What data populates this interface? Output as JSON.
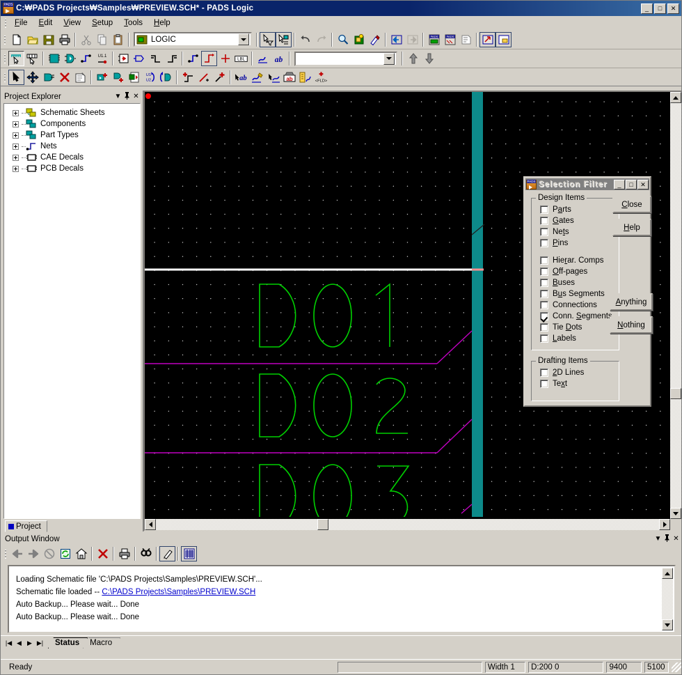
{
  "window": {
    "title": "C:₩PADS Projects₩Samples₩PREVIEW.SCH* - PADS Logic",
    "icon": "pads-app-icon",
    "minimize": "_",
    "maximize": "□",
    "close": "✕"
  },
  "menubar": {
    "items": [
      {
        "label": "File",
        "accel": "F"
      },
      {
        "label": "Edit",
        "accel": "E"
      },
      {
        "label": "View",
        "accel": "V"
      },
      {
        "label": "Setup",
        "accel": "S"
      },
      {
        "label": "Tools",
        "accel": "T"
      },
      {
        "label": "Help",
        "accel": "H"
      }
    ]
  },
  "toolbar_standard": {
    "sheet_combo": {
      "value": "LOGIC",
      "icon": "sheet-icon",
      "arrow": "chevron-down-icon"
    },
    "buttons": [
      "new-file-icon",
      "open-file-icon",
      "save-icon",
      "print-icon",
      "cut-icon",
      "copy-icon",
      "paste-icon",
      "selection-filter-icon",
      "query-modify-icon",
      "undo-icon",
      "redo-icon",
      "zoom-icon",
      "zoom-area-icon",
      "redraw-icon",
      "back-sheet-icon",
      "forward-sheet-icon",
      "pads-router-icon",
      "pads-layout-icon",
      "properties-icon",
      "ole-link-icon",
      "ole-object-icon"
    ]
  },
  "toolbar_design": {
    "filter_value": "",
    "arrow_up": "move-up-icon",
    "arrow_down": "move-down-icon",
    "buttons": [
      "select-net-icon",
      "select-comp-icon",
      "add-part-icon",
      "add-gate-icon",
      "add-connection-icon",
      "add-pin-icon",
      "hierarchical-comp-icon",
      "off-page-icon",
      "bus-icon",
      "bus-segment-icon",
      "connection-icon",
      "conn-segment-icon",
      "tie-dot-icon",
      "label-icon",
      "2d-line-icon",
      "text-icon"
    ]
  },
  "toolbar_edit": {
    "buttons": [
      "select-icon",
      "move-icon",
      "rotate-icon",
      "delete-icon",
      "edit-props-icon",
      "add-part2-icon",
      "add-gate2-icon",
      "add-sheet-icon",
      "swap-refdes-icon",
      "swap-gates-icon",
      "add-conn2-icon",
      "split-conn-icon",
      "add-vertex-icon",
      "rename-net-icon",
      "edit-text-icon",
      "edit-label-icon",
      "attr-icon",
      "field-icon",
      "add-field-icon"
    ]
  },
  "project_explorer": {
    "title": "Project Explorer",
    "dropdown": "▼",
    "pin": "pin-icon",
    "close": "✕",
    "items": [
      {
        "label": "Schematic Sheets",
        "icon": "schematic-sheets-icon",
        "expander": "+"
      },
      {
        "label": "Components",
        "icon": "components-icon",
        "expander": "+"
      },
      {
        "label": "Part Types",
        "icon": "part-types-icon",
        "expander": "+"
      },
      {
        "label": "Nets",
        "icon": "nets-icon",
        "expander": "+"
      },
      {
        "label": "CAE Decals",
        "icon": "cae-decals-icon",
        "expander": "+"
      },
      {
        "label": "PCB Decals",
        "icon": "pcb-decals-icon",
        "expander": "+"
      }
    ],
    "tab": {
      "label": "Project",
      "icon": "project-tab-icon"
    }
  },
  "canvas": {
    "background": "#000000",
    "grid_dot_color": "#ffffff",
    "net_green": "#00d000",
    "bus_magenta": "#c000c0",
    "white_line": "#ffffff",
    "pink_line": "#ff9090",
    "teal_band": "#0d8a8a",
    "origin_marker": "#ff0000",
    "labels": [
      "D01",
      "D02",
      "D03"
    ]
  },
  "selection_filter": {
    "title": "Selection Filter",
    "icon": "pads-app-icon",
    "minimize": "_",
    "maximize": "□",
    "close": "✕",
    "groups": [
      {
        "label": "Design Items",
        "items": [
          {
            "label": "Parts",
            "accel_index": 1,
            "checked": false
          },
          {
            "label": "Gates",
            "accel_index": 0,
            "checked": false
          },
          {
            "label": "Nets",
            "accel_index": 2,
            "checked": false
          },
          {
            "label": "Pins",
            "accel_index": 0,
            "checked": false
          },
          {
            "label": "Hierar. Comps",
            "accel_index": 4,
            "checked": false
          },
          {
            "label": "Off-pages",
            "accel_index": 0,
            "checked": false
          },
          {
            "label": "Buses",
            "accel_index": 0,
            "checked": false
          },
          {
            "label": "Bus Segments",
            "accel_index": 1,
            "checked": false
          },
          {
            "label": "Connections",
            "accel_index": 0,
            "checked": false
          },
          {
            "label": "Conn. Segments",
            "accel_index": 6,
            "checked": true
          },
          {
            "label": "Tie Dots",
            "accel_index": 4,
            "checked": false
          },
          {
            "label": "Labels",
            "accel_index": 0,
            "checked": false
          }
        ]
      },
      {
        "label": "Drafting Items",
        "items": [
          {
            "label": "2D Lines",
            "accel_index": 0,
            "checked": false
          },
          {
            "label": "Text",
            "accel_index": 2,
            "checked": false
          }
        ]
      }
    ],
    "buttons": [
      {
        "label": "Close",
        "accel_index": 0
      },
      {
        "label": "Help",
        "accel_index": 0
      },
      {
        "label": "Anything",
        "accel_index": 0
      },
      {
        "label": "Nothing",
        "accel_index": 0
      }
    ]
  },
  "output_window": {
    "title": "Output Window",
    "dropdown": "▼",
    "pin": "pin-icon",
    "close": "✕",
    "toolbar": [
      "back-icon",
      "forward-icon",
      "stop-icon",
      "refresh-icon",
      "home-icon",
      "clear-icon",
      "print-icon",
      "find-icon",
      "edit-icon",
      "list-icon"
    ],
    "lines": [
      {
        "text": "Loading Schematic file 'C:\\PADS Projects\\Samples\\PREVIEW.SCH'...",
        "link": null
      },
      {
        "text": "Schematic file loaded -- ",
        "link": "C:\\PADS Projects\\Samples\\PREVIEW.SCH"
      },
      {
        "text": "Auto Backup... Please wait... Done",
        "link": null
      },
      {
        "text": "Auto Backup... Please wait... Done",
        "link": null
      }
    ],
    "tabs": [
      {
        "label": "Status",
        "active": true
      },
      {
        "label": "Macro",
        "active": false
      }
    ],
    "nav": [
      "|◀",
      "◀",
      "▶",
      "▶|"
    ]
  },
  "statusbar": {
    "message": "Ready",
    "fields": [
      {
        "name": "coordinate-message",
        "value": ""
      },
      {
        "name": "width-field",
        "value": "Width     1"
      },
      {
        "name": "design-field",
        "value": "D:200 0"
      },
      {
        "name": "x-coordinate",
        "value": "9400"
      },
      {
        "name": "y-coordinate",
        "value": "5100"
      }
    ]
  }
}
